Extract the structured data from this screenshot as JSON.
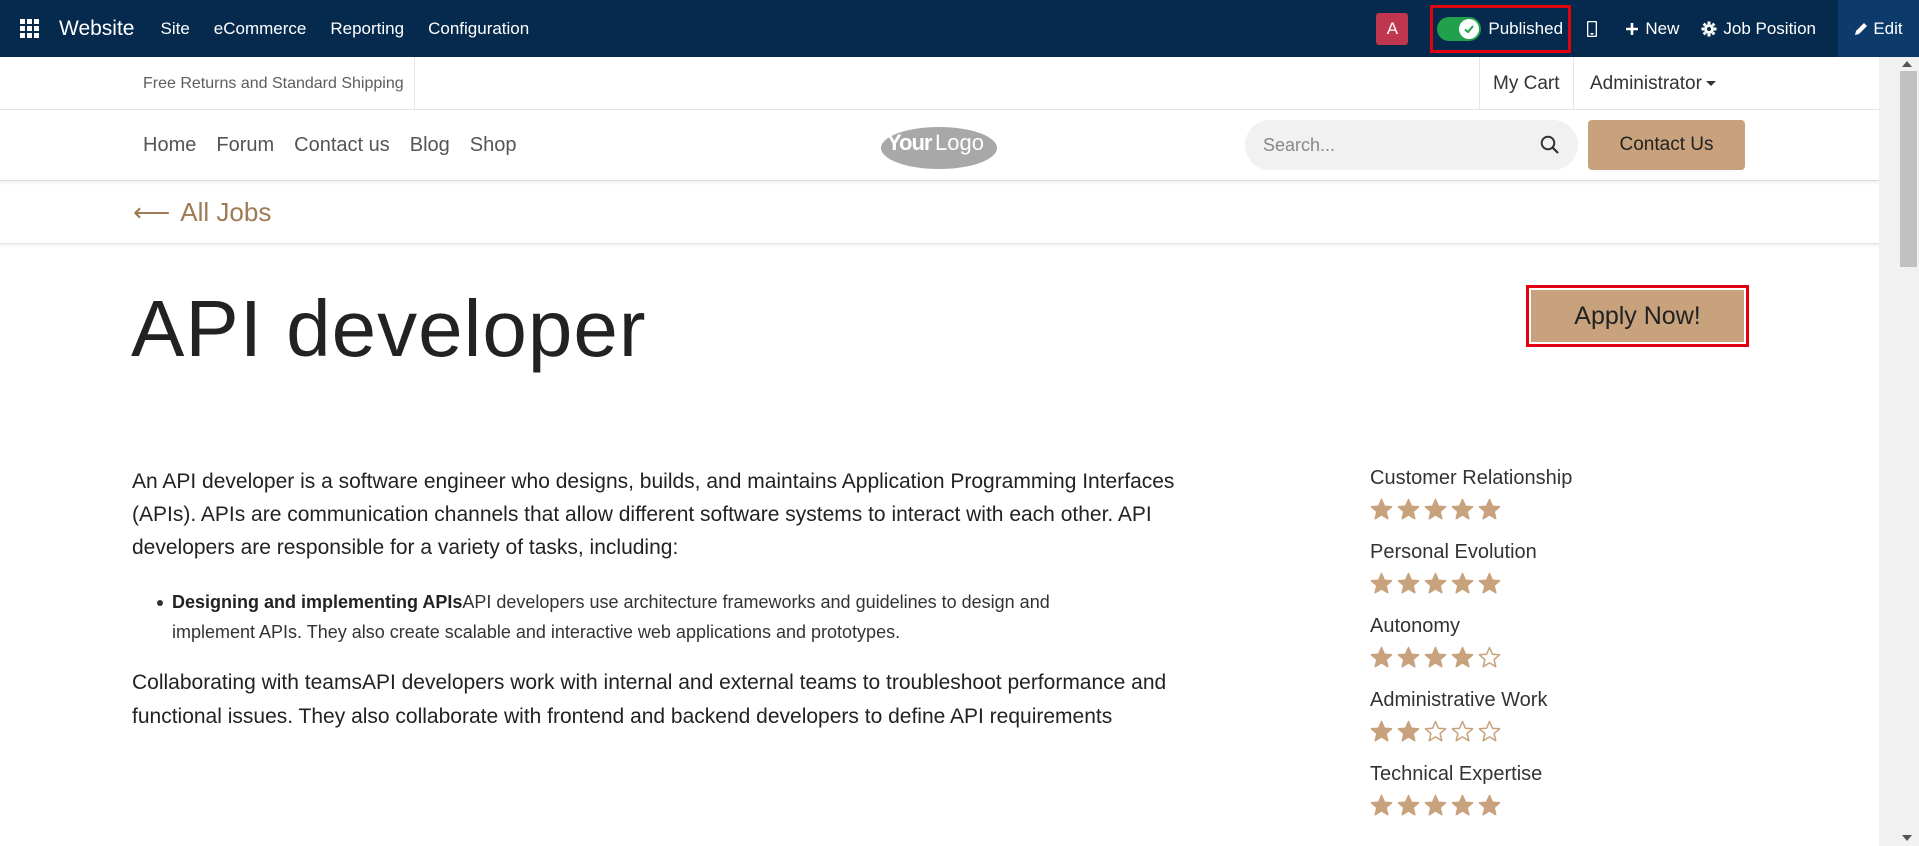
{
  "admin_bar": {
    "brand": "Website",
    "menu": [
      "Site",
      "eCommerce",
      "Reporting",
      "Configuration"
    ],
    "avatar_letter": "A",
    "published_label": "Published",
    "new_label": "New",
    "job_position_label": "Job Position",
    "edit_label": "Edit"
  },
  "promo": {
    "text": "Free Returns and Standard Shipping",
    "cart_label": "My Cart",
    "user_label": "Administrator"
  },
  "nav": {
    "links": [
      "Home",
      "Forum",
      "Contact us",
      "Blog",
      "Shop"
    ],
    "logo_text_bold": "Your",
    "logo_text_light": "Logo",
    "search_placeholder": "Search...",
    "contact_button": "Contact Us"
  },
  "breadcrumb": {
    "arrow": "⟵",
    "label": "All Jobs"
  },
  "job": {
    "title": "API developer",
    "apply_label": "Apply Now!",
    "description": "An API developer is a software engineer who designs, builds, and maintains Application Programming Interfaces (APIs). APIs are communication channels that allow different software systems to interact with each other. API developers are responsible for a variety of tasks, including:",
    "bullet_title": "Designing and implementing APIs",
    "bullet_text": "API developers use architecture frameworks and guidelines to design and implement APIs. They also create scalable and interactive web applications and prototypes.",
    "description2": "Collaborating with teamsAPI developers work with internal and external teams to troubleshoot performance and functional issues. They also collaborate with frontend and backend developers to define API requirements"
  },
  "skills": [
    {
      "name": "Customer Relationship",
      "rating": 5,
      "max": 5
    },
    {
      "name": "Personal Evolution",
      "rating": 5,
      "max": 5
    },
    {
      "name": "Autonomy",
      "rating": 4,
      "max": 5
    },
    {
      "name": "Administrative Work",
      "rating": 2,
      "max": 5
    },
    {
      "name": "Technical Expertise",
      "rating": 5,
      "max": 5
    }
  ],
  "colors": {
    "admin_bar": "#062a4d",
    "accent": "#c8a27c",
    "highlight_border": "#e3000f",
    "toggle_on": "#21a04d",
    "star": "#c8a27c"
  }
}
